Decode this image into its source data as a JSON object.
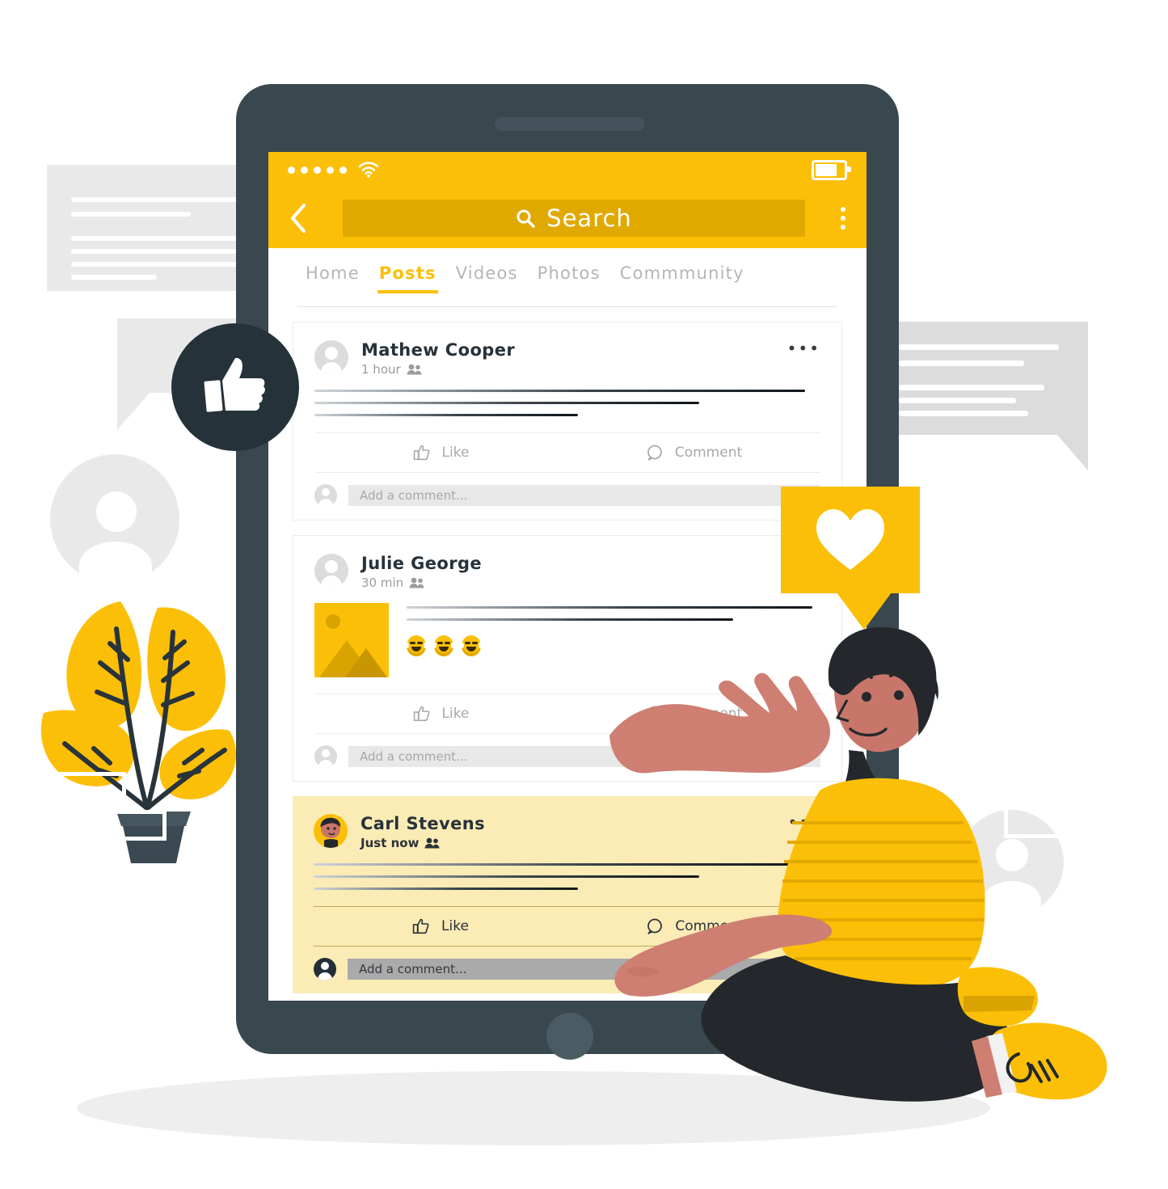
{
  "app": {
    "status_bar": {
      "signal_dots": 5,
      "wifi_icon": "wifi-icon",
      "battery_icon": "battery-icon",
      "battery_level": "68%"
    },
    "header": {
      "back_icon": "chevron-left-icon",
      "search_icon": "search-icon",
      "search_placeholder": "Search",
      "menu_icon": "kebab-menu-icon"
    },
    "tabs": [
      {
        "label": "Home",
        "active": false
      },
      {
        "label": "Posts",
        "active": true
      },
      {
        "label": "Videos",
        "active": false
      },
      {
        "label": "Photos",
        "active": false
      },
      {
        "label": "Commmunity",
        "active": false
      }
    ],
    "posts": [
      {
        "author": "Mathew Cooper",
        "time": "1 hour",
        "audience_icon": "friends-icon",
        "more_icon": "more-options-icon",
        "has_image": false,
        "has_reactions": false,
        "highlight": false,
        "like_label": "Like",
        "like_icon": "thumbs-up-icon",
        "comment_label": "Comment",
        "comment_icon": "comment-bubble-icon",
        "comment_placeholder": "Add a comment...",
        "body_lines": 3
      },
      {
        "author": "Julie George",
        "time": "30 min",
        "audience_icon": "friends-icon",
        "more_icon": "more-options-icon",
        "has_image": true,
        "image_icon": "photo-thumbnail",
        "has_reactions": true,
        "reactions": [
          "laughing-emoji",
          "laughing-emoji",
          "laughing-emoji"
        ],
        "highlight": false,
        "like_label": "Like",
        "like_icon": "thumbs-up-icon",
        "comment_label": "Comment",
        "comment_icon": "comment-bubble-icon",
        "comment_placeholder": "Add a comment...",
        "body_lines": 2
      },
      {
        "author": "Carl Stevens",
        "time": "Just now",
        "audience_icon": "friends-icon",
        "more_icon": "more-options-icon",
        "has_image": false,
        "has_reactions": false,
        "highlight": true,
        "like_label": "Like",
        "like_icon": "thumbs-up-icon",
        "comment_label": "Comment",
        "comment_icon": "comment-bubble-icon",
        "comment_placeholder": "Add a comment...",
        "body_lines": 3
      }
    ],
    "bottom_nav": {
      "home_icon": "home-icon",
      "expand_icon": "chevron-down-circle-icon"
    }
  },
  "floating": {
    "like_badge_icon": "thumbs-up-badge-icon",
    "heart_badge_icon": "heart-badge-icon"
  },
  "decor": {
    "plant_icon": "potted-plant-illustration",
    "person_icon": "seated-man-illustration",
    "avatar_placeholder_icon": "user-avatar-placeholder"
  },
  "colors": {
    "brand_yellow": "#FCBF07",
    "search_field": "#E0A900",
    "dark_slate": "#39474e",
    "badge_dark": "#26323a",
    "highlight_card": "#FBEBB5",
    "skin": "#C8766A",
    "muted_text": "#b5b5b5"
  }
}
